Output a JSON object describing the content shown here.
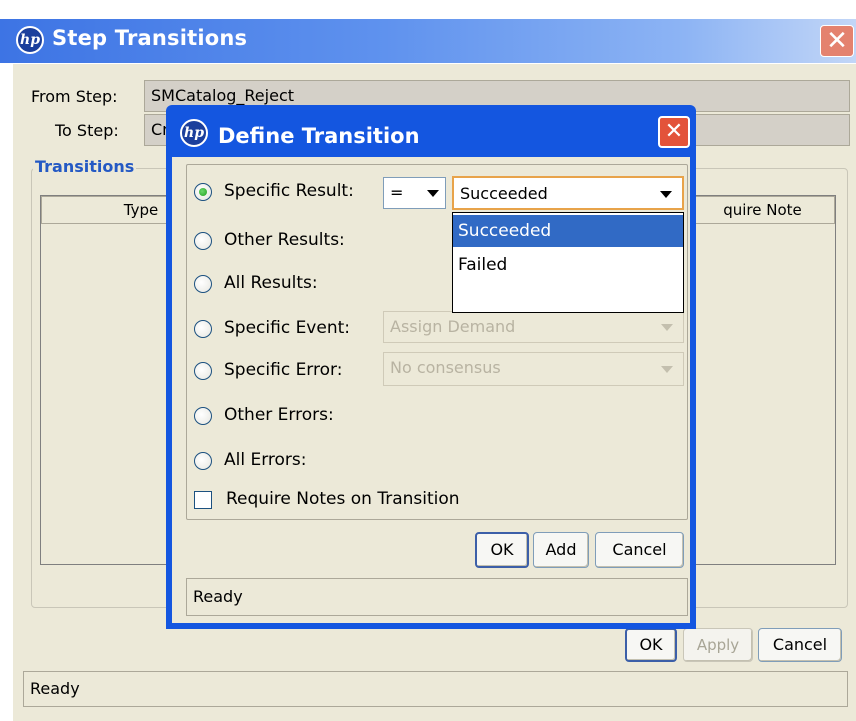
{
  "outer_window": {
    "title": "Step Transitions",
    "logo": "hp",
    "close_icon": "close-icon",
    "from_step_label": "From Step:",
    "from_step_value": "SMCatalog_Reject",
    "to_step_label": "To Step:",
    "to_step_value": "Cr",
    "transitions_group_title": "Transitions",
    "columns": [
      "Type",
      "quire Note"
    ],
    "ok_label": "OK",
    "apply_label": "Apply",
    "cancel_label": "Cancel",
    "status": "Ready"
  },
  "define_transition": {
    "title": "Define Transition",
    "logo": "hp",
    "close_icon": "close-icon",
    "options": {
      "specific_result": "Specific Result:",
      "other_results": "Other Results:",
      "all_results": "All Results:",
      "specific_event": "Specific Event:",
      "specific_error": "Specific Error:",
      "other_errors": "Other Errors:",
      "all_errors": "All Errors:"
    },
    "selected_option": "specific_result",
    "operator_value": "=",
    "result_value": "Succeeded",
    "result_dropdown_options": [
      "Succeeded",
      "Failed"
    ],
    "result_dropdown_highlighted": "Succeeded",
    "event_value": "Assign Demand",
    "error_value": "No consensus",
    "require_notes_label": "Require Notes on Transition",
    "require_notes_checked": false,
    "ok_label": "OK",
    "add_label": "Add",
    "cancel_label": "Cancel",
    "status": "Ready"
  },
  "colors": {
    "title_bar_active": "#1456e0",
    "title_bar_inactive": "#5f92ee",
    "dialog_background": "#ece9d8",
    "selection": "#316ac5",
    "group_title": "#2459c4"
  }
}
